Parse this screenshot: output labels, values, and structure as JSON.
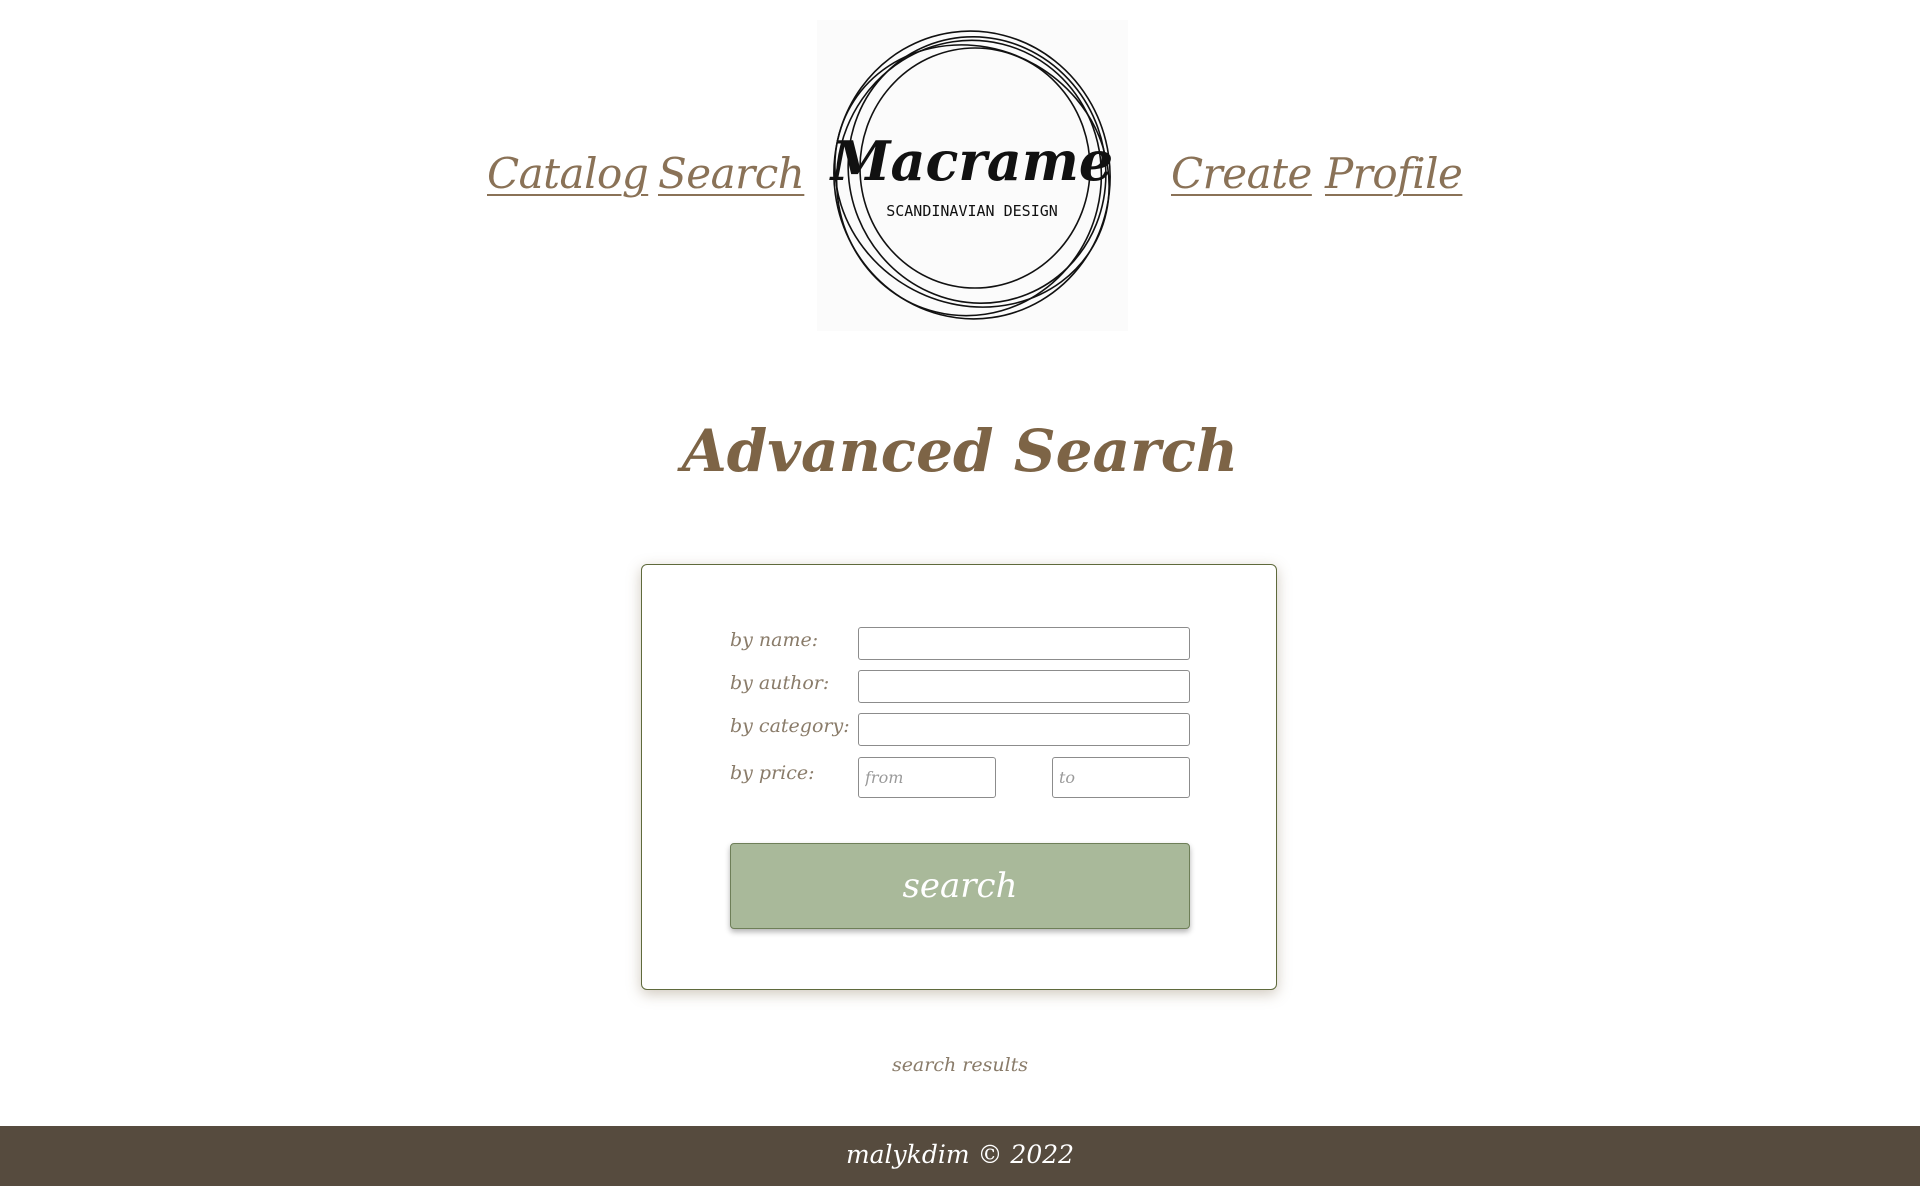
{
  "nav": {
    "catalog_label": "Catalog",
    "search_label": "Search",
    "create_label": "Create",
    "profile_label": "Profile"
  },
  "logo": {
    "brand": "Macrame",
    "tagline": "SCANDINAVIAN DESIGN"
  },
  "page_title": "Advanced Search",
  "form": {
    "name_label": "by name:",
    "name_value": "",
    "author_label": "by author:",
    "author_value": "",
    "category_label": "by category:",
    "category_value": "",
    "price_label": "by price:",
    "price_from_placeholder": "from",
    "price_to_placeholder": "to",
    "search_button_label": "search"
  },
  "results_label": "search results",
  "footer": {
    "text": "malykdim © 2022"
  },
  "colors": {
    "nav_link": "#8a7257",
    "title": "#7d6446",
    "button_bg": "#a9b99a",
    "card_border": "#5f6a3c",
    "footer_bg": "#564b3e",
    "label": "#8a7c6a"
  }
}
